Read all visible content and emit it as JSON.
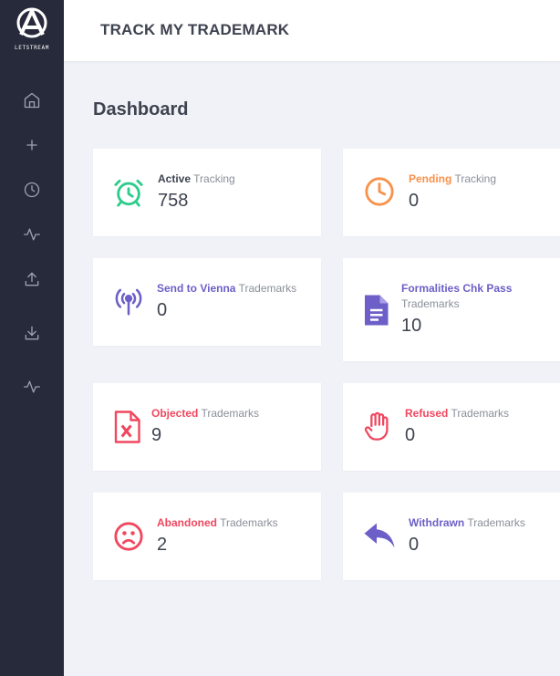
{
  "brand": {
    "logo_text": "LETSTREAM"
  },
  "header": {
    "title": "TRACK MY TRADEMARK"
  },
  "page": {
    "title": "Dashboard"
  },
  "sidebar": {
    "items": [
      {
        "icon": "home-icon"
      },
      {
        "icon": "plus-icon"
      },
      {
        "icon": "clock-icon"
      },
      {
        "icon": "activity-icon"
      },
      {
        "icon": "upload-icon"
      },
      {
        "icon": "download-icon"
      },
      {
        "icon": "activity-icon"
      }
    ]
  },
  "colors": {
    "sidebar_bg": "#272a3a",
    "green": "#2ecc8b",
    "orange": "#f9914a",
    "purple": "#6c5fc7",
    "red": "#f0475f"
  },
  "cards": {
    "active": {
      "strong": "Active",
      "rest": " Tracking",
      "value": "758",
      "icon": "alarm-clock-icon",
      "color": "#2ecc8b",
      "strong_color": "#3e4350"
    },
    "pending": {
      "strong": "Pending",
      "rest": " Tracking",
      "value": "0",
      "icon": "clock-icon",
      "color": "#f9914a"
    },
    "vienna": {
      "strong": "Send to Vienna",
      "rest": " Trademarks",
      "value": "0",
      "icon": "broadcast-icon",
      "color": "#6c5fc7"
    },
    "formalities": {
      "strong": "Formalities Chk Pass",
      "rest": "Trademarks",
      "value": "10",
      "icon": "document-icon",
      "color": "#6c5fc7"
    },
    "objected": {
      "strong": "Objected",
      "rest": " Trademarks",
      "value": "9",
      "icon": "excel-file-icon",
      "color": "#f0475f"
    },
    "refused": {
      "strong": "Refused",
      "rest": " Trademarks",
      "value": "0",
      "icon": "hand-stop-icon",
      "color": "#f0475f"
    },
    "abandoned": {
      "strong": "Abandoned",
      "rest": " Trademarks",
      "value": "2",
      "icon": "sad-face-icon",
      "color": "#f0475f"
    },
    "withdrawn": {
      "strong": "Withdrawn",
      "rest": " Trademarks",
      "value": "0",
      "icon": "reply-arrow-icon",
      "color": "#6c5fc7"
    }
  }
}
